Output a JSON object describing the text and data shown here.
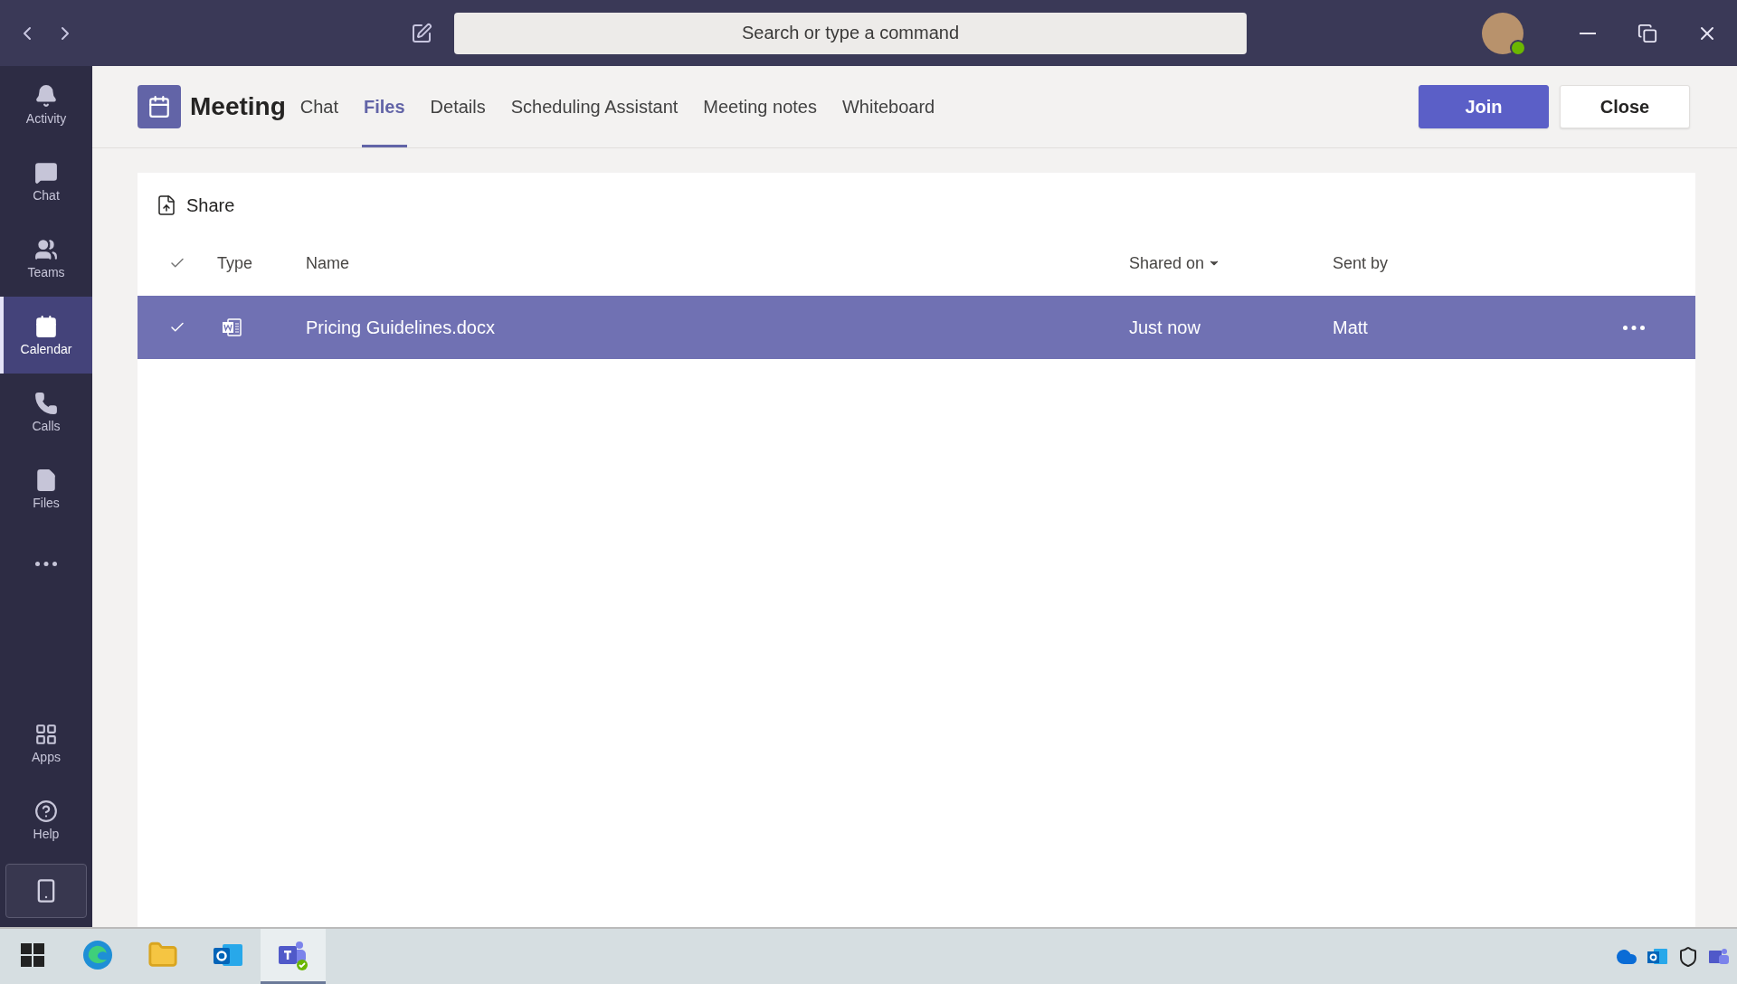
{
  "titlebar": {
    "search": {
      "placeholder": "Search or type a command"
    }
  },
  "sidebar": {
    "items": [
      {
        "label": "Activity",
        "selected": false
      },
      {
        "label": "Chat",
        "selected": false
      },
      {
        "label": "Teams",
        "selected": false
      },
      {
        "label": "Calendar",
        "selected": true
      },
      {
        "label": "Calls",
        "selected": false
      },
      {
        "label": "Files",
        "selected": false
      }
    ],
    "bottom_items": [
      {
        "label": "Apps"
      },
      {
        "label": "Help"
      }
    ]
  },
  "header": {
    "title": "Meeting",
    "tabs": [
      {
        "label": "Chat",
        "selected": false
      },
      {
        "label": "Files",
        "selected": true
      },
      {
        "label": "Details",
        "selected": false
      },
      {
        "label": "Scheduling Assistant",
        "selected": false
      },
      {
        "label": "Meeting notes",
        "selected": false
      },
      {
        "label": "Whiteboard",
        "selected": false
      }
    ],
    "buttons": [
      {
        "label": "Join",
        "kind": "primary"
      },
      {
        "label": "Close",
        "kind": "secondary"
      }
    ]
  },
  "files": {
    "share": "Share",
    "select_all": {
      "checked": true
    },
    "columns": [
      "Type",
      "Name",
      "Shared on",
      "Sent by"
    ],
    "rows": [
      {
        "name": "Pricing Guidelines.docx",
        "shared_on": "Just now",
        "sent_by": "Matt",
        "selected": true
      }
    ]
  },
  "taskbar": {
    "apps": [
      {
        "selected": false
      },
      {
        "selected": false
      },
      {
        "selected": false
      },
      {
        "selected": true
      }
    ]
  }
}
